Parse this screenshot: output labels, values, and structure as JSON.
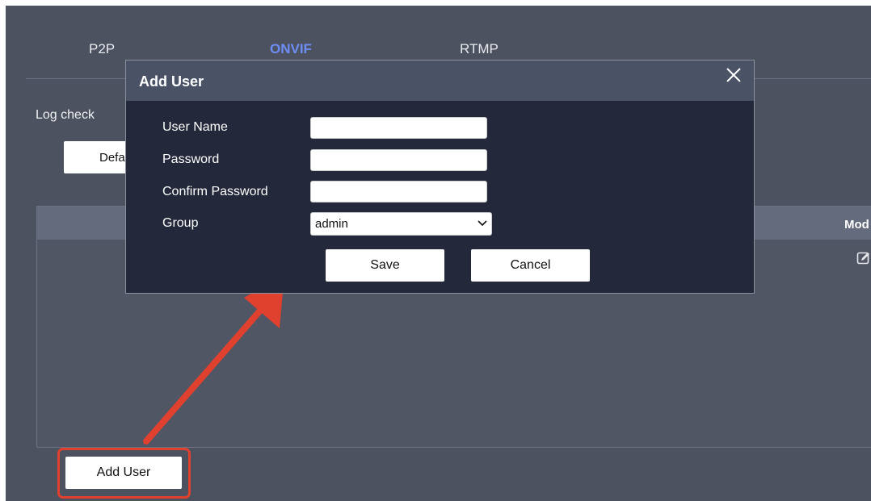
{
  "tabs": [
    {
      "label": "P2P",
      "active": false
    },
    {
      "label": "ONVIF",
      "active": true
    },
    {
      "label": "RTMP",
      "active": false
    }
  ],
  "log_check_label": "Log check",
  "default_button_label": "Defa",
  "table": {
    "columns": [
      {
        "label": "Mod"
      }
    ]
  },
  "add_user_button_label": "Add User",
  "modal": {
    "title": "Add User",
    "fields": {
      "user_name": {
        "label": "User Name",
        "value": ""
      },
      "password": {
        "label": "Password",
        "value": ""
      },
      "confirm_password": {
        "label": "Confirm Password",
        "value": ""
      },
      "group": {
        "label": "Group",
        "selected": "admin"
      }
    },
    "save_label": "Save",
    "cancel_label": "Cancel"
  },
  "colors": {
    "background": "#4d5260",
    "active_tab": "#6e8ef5",
    "modal_header": "#4a5366",
    "modal_body": "#23293a",
    "highlight": "#e0402e"
  },
  "icons": [
    "close-icon",
    "edit-icon",
    "chevron-down-icon",
    "arrow-annotation"
  ]
}
